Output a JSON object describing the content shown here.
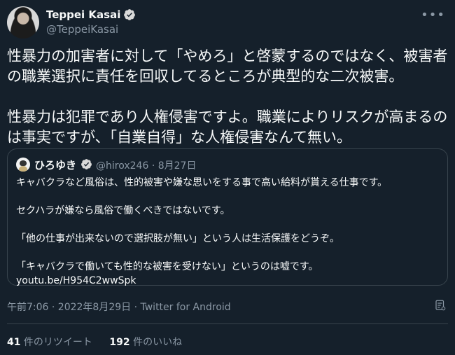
{
  "author": {
    "display_name": "Teppei Kasai",
    "handle": "@TeppeiKasai",
    "verified": true
  },
  "tweet": {
    "text": "性暴力の加害者に対して「やめろ」と啓蒙するのではなく、被害者の職業選択に責任を回収してるところが典型的な二次被害。\n\n性暴力は犯罪であり人権侵害ですよ。職業によりリスクが高まるのは事実ですが、「自業自得」な人権侵害なんて無い。"
  },
  "quoted_tweet": {
    "display_name": "ひろゆき",
    "handle": "@hirox246",
    "separator": "·",
    "date": "8月27日",
    "text": "キャバクラなど風俗は、性的被害や嫌な思いをする事で高い給料が貰える仕事です。\n\nセクハラが嫌なら風俗で働くべきではないです。\n\n「他の仕事が出来ないので選択肢が無い」という人は生活保護をどうぞ。\n\n「キャバクラで働いても性的な被害を受けない」というのは嘘です。",
    "link": "youtu.be/H954C2wwSpk"
  },
  "meta": {
    "timestamp": "午前7:06 · 2022年8月29日 · Twitter for Android"
  },
  "stats": {
    "retweets_count": "41",
    "retweets_label": " 件のリツイート",
    "likes_count": "192",
    "likes_label": " 件のいいね"
  },
  "icons": {
    "more": "more-options-icon",
    "verified": "verified-badge-icon",
    "analytics": "analytics-icon"
  },
  "colors": {
    "background": "#15202b",
    "text": "#f7f9f9",
    "secondary": "#8b98a5",
    "border": "#38444d",
    "verified": "#d9d9d9"
  }
}
